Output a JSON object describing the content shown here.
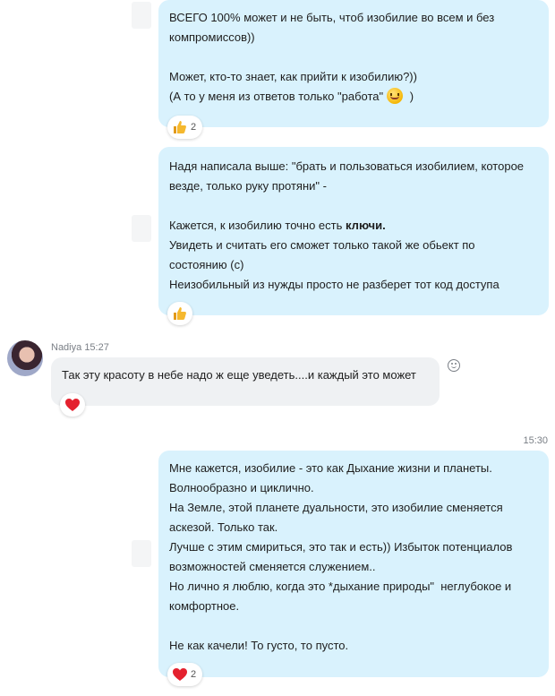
{
  "messages": {
    "m1": {
      "line1": "ВСЕГО 100% может и не быть, чтоб изобилие во всем и без",
      "line2": "компромиссов))",
      "line3": "Может, кто-то знает, как прийти к изобилию?))",
      "line4_before": "(А то у меня из ответов только \"работа\"",
      "line4_after": " )",
      "reaction_count": "2"
    },
    "m2": {
      "line1": "Надя написала выше: \"брать и пользоваться изобилием, которое",
      "line2": "везде, только руку протяни\" -",
      "line3_before": "Кажется, к изобилию точно есть ",
      "line3_bold": "ключи.",
      "line4": "Увидеть и считать его сможет только такой же обьект по",
      "line5": "состоянию (с)",
      "line6": "Неизобильный из нужды просто не разберет тот код доступа"
    },
    "m3": {
      "sender": "Nadiya",
      "time": "15:27",
      "text": "Так эту красоту в небе надо ж еще уведеть....и каждый это может"
    },
    "m4": {
      "time": "15:30",
      "line1": "Мне кажется, изобилие - это как Дыхание жизни и планеты.",
      "line2": "Волнообразно и циклично.",
      "line3": "На Земле, этой планете дуальности, это изобилие сменяется",
      "line4": "аскезой. Только так.",
      "line5": "Лучше с этим смириться, это так и есть)) Избыток потенциалов",
      "line6": "возможностей сменяется служением..",
      "line7": "Но лично я люблю, когда это *дыхание природы\"  неглубокое и",
      "line8": "комфортное.",
      "line9": "Не как качели! То густо, то пусто.",
      "reaction_count": "2"
    }
  },
  "icons": {
    "thumbs_up": "thumbs-up-icon",
    "heart": "heart-icon",
    "emoji_smile": "smile-emoji",
    "add_reaction": "add-reaction-icon"
  },
  "colors": {
    "outgoing_bubble": "#d9f2fd",
    "incoming_bubble": "#eff1f3",
    "heart": "#e4212e",
    "thumb": "#f5b82e"
  }
}
